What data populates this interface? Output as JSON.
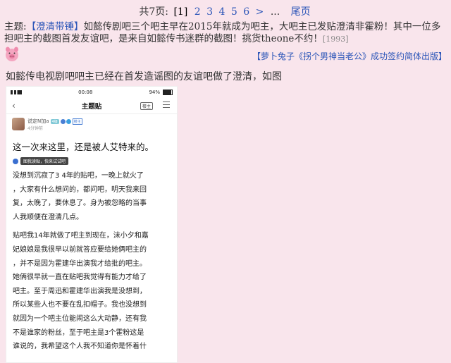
{
  "pager": {
    "total_label": "共7页:",
    "current": "[1]",
    "pages": [
      "2",
      "3",
      "4",
      "5",
      "6"
    ],
    "next": ">",
    "ellipsis": "...",
    "last": "尾页"
  },
  "topic": {
    "prefix": "主题:",
    "tag": "【澄清带锤】",
    "text": "如懿传剧吧三个吧主早在2015年就成为吧主，大吧主已发贴澄清非霍粉！其中一位多担吧主的截图首发友谊吧，是来自如懿传书迷群的截图！挑货theone不约！",
    "count": "[1993]"
  },
  "credit": "【萝卜兔子《拐个男神当老公》成功签约简体出版】",
  "intro": "如懿传电视剧吧吧主已经在首发造谣图的友谊吧做了澄清，如图",
  "phone": {
    "status_time": "00:08",
    "battery": "94%",
    "nav_title": "主题贴",
    "sort_label": "楼主",
    "author_name": "说定N加a",
    "author_level": "4级",
    "author_badge": "楼主",
    "post_time": "4分钟前",
    "post_title": "这一次来这里，还是被人艾特来的。",
    "tip_text": "图我读贴，快来试试吧",
    "lines": [
      "没想到沉寂了3 4年的贴吧，一晚上就火了",
      "，大家有什么想问的，都问吧，明天我来回",
      "复，太晚了，要休息了。身为被忽略的当事",
      "人我顺便在澄清几点。",
      "",
      "贴吧我14年就做了吧主到现在，沫小夕和嘉",
      "妃娘娘是我很早以前就答应要给她俩吧主的",
      "，并不是因为霍建华出演我才给批的吧主。",
      "她俩很早就一直在贴吧我觉得有能力才给了",
      "吧主。至于周迅和霍建华出演我是没想到，",
      "所以某些人也不要在乱扣帽子。我也没想到",
      "就因为一个吧主位能闹这么大动静，还有我",
      "不是谁家的粉丝，至于吧主是3个霍粉这是",
      "谁说的，我希望这个人我不知道你是怀着什"
    ]
  }
}
